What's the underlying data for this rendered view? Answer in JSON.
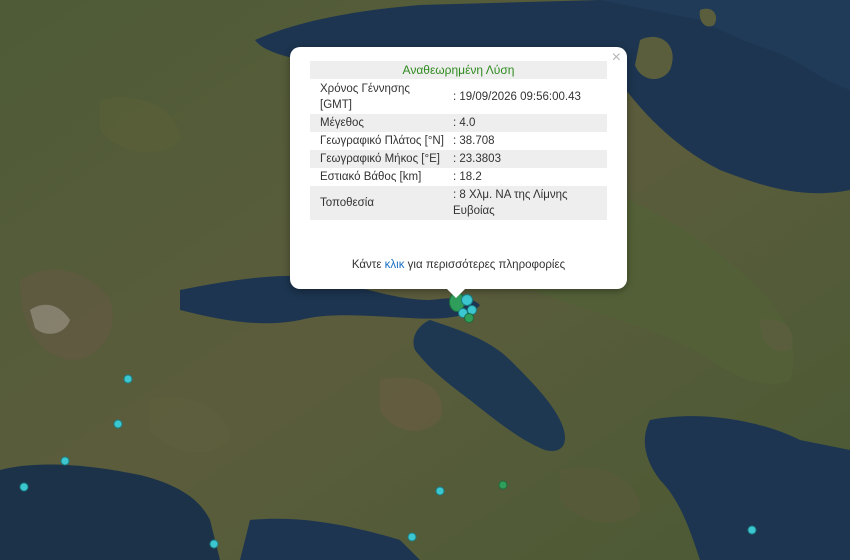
{
  "popup": {
    "title": "Αναθεωρημένη Λύση",
    "close_symbol": "×",
    "rows": [
      {
        "label": "Χρόνος Γέννησης [GMT]",
        "value": ": 19/09/2026 09:56:00.43"
      },
      {
        "label": "Μέγεθος",
        "value": ": 4.0"
      },
      {
        "label": "Γεωγραφικό Πλάτος [°N]",
        "value": ": 38.708"
      },
      {
        "label": "Γεωγραφικό Μήκος [°E]",
        "value": ": 23.3803"
      },
      {
        "label": "Εστιακό Βάθος [km]",
        "value": ": 18.2"
      },
      {
        "label": "Τοποθεσία",
        "value": ": 8 Χλμ. ΝΑ της Λίμνης Ευβοίας"
      }
    ],
    "more_prefix": "Κάντε ",
    "more_link": "κλικ",
    "more_suffix": " για περισσότερες πληροφορίες"
  },
  "colors": {
    "marker_cyan": "#3cc7d0",
    "marker_green": "#2e9e5a",
    "title_green": "#2e8b1e",
    "link_blue": "#1a6fc4",
    "sea": "#1b3248",
    "land": "#4d5a34"
  }
}
